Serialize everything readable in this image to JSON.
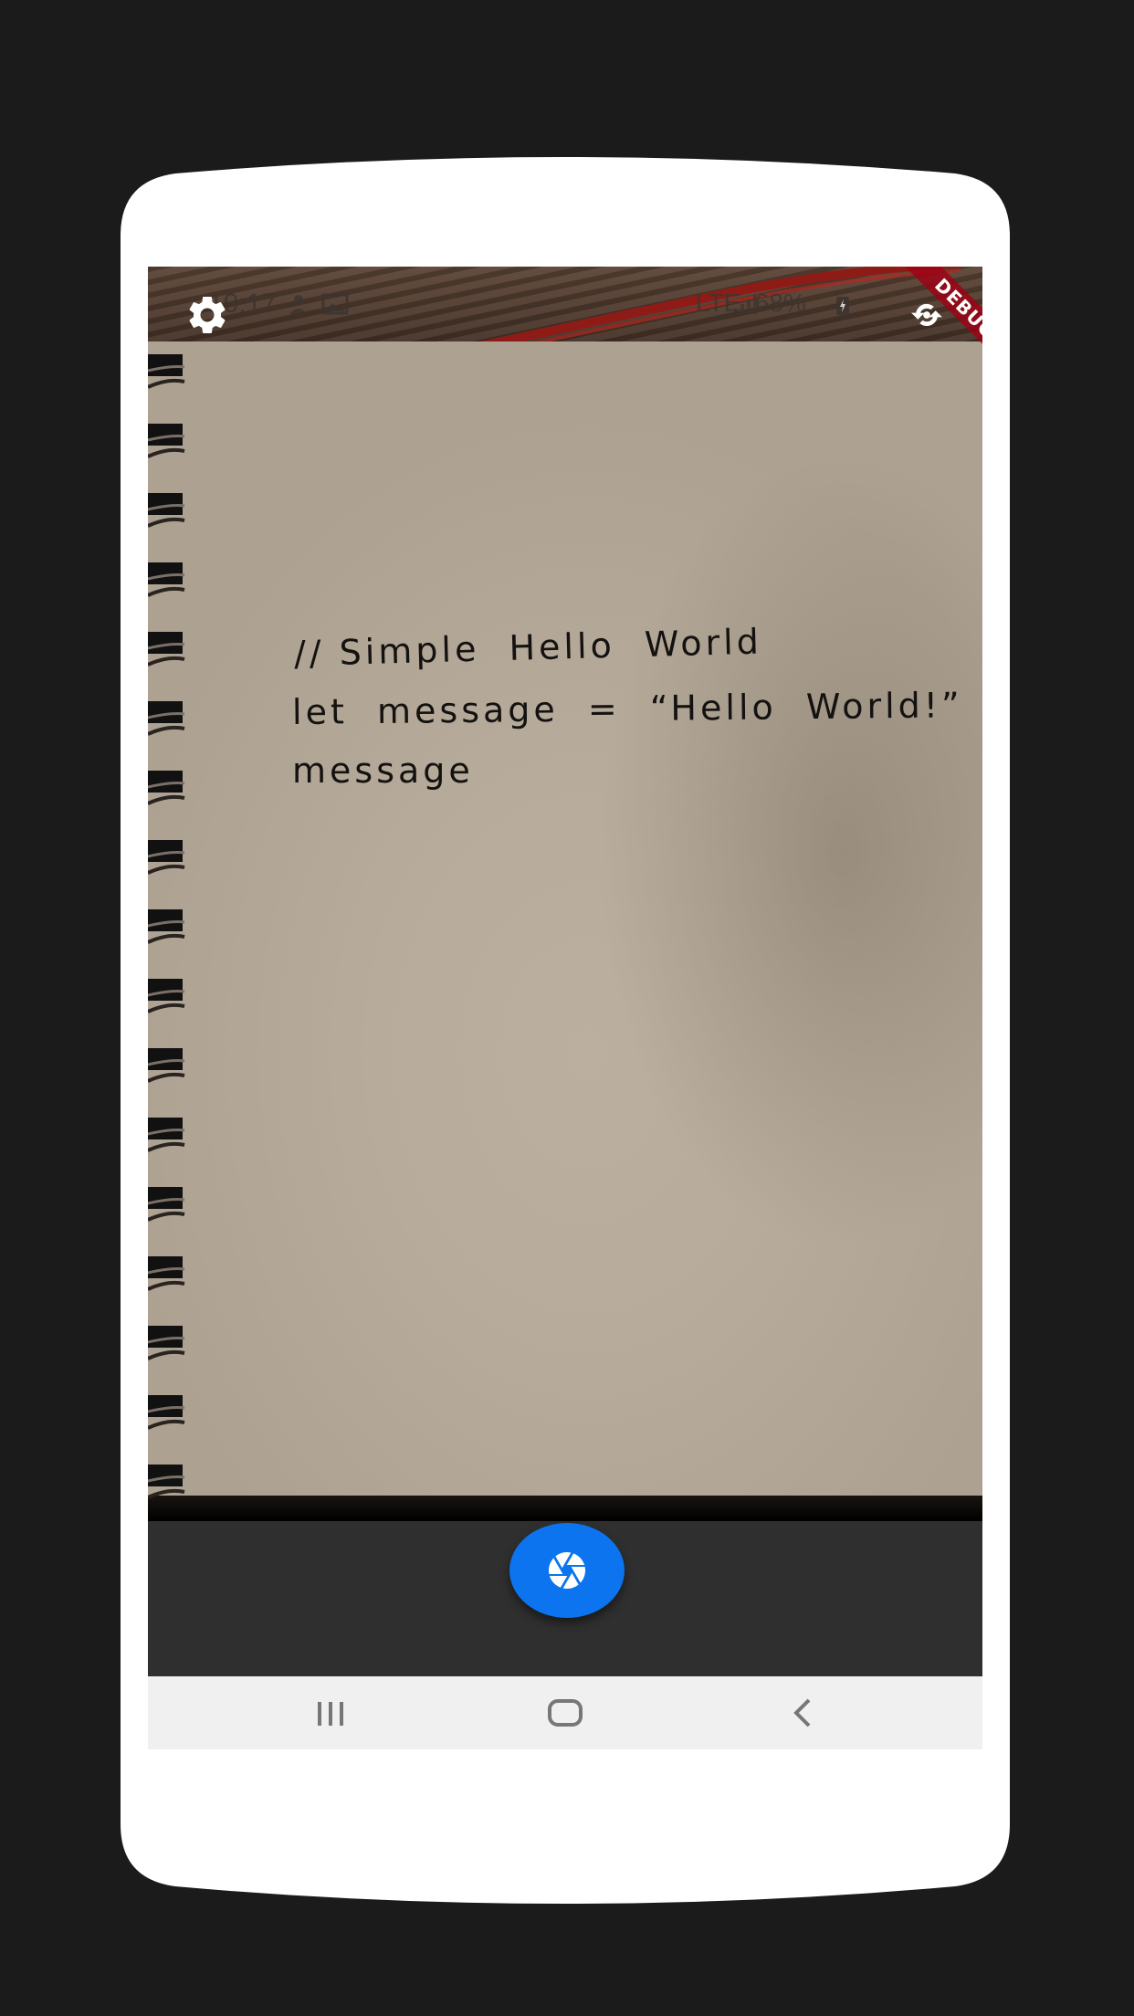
{
  "status_bar": {
    "time": "10:17",
    "right_text": "LTE  68%",
    "battery_percent": "68%",
    "network": "LTE",
    "icons": [
      "person-notification-icon",
      "image-notification-icon",
      "alarm-icon",
      "mute-icon",
      "sd-card-icon",
      "wifi-icon",
      "signal-icon",
      "battery-charging-icon"
    ]
  },
  "debug_banner": {
    "label": "DEBUG"
  },
  "handwriting": {
    "line1": "// Simple  Hello  World",
    "line2": "let  message  =  “Hello  World!”",
    "line3": "message"
  },
  "toolbar": {
    "settings_icon": "gear-icon",
    "flip_camera_icon": "flip-camera-icon",
    "shutter_icon": "camera-shutter-icon"
  },
  "nav_bar": {
    "recents_icon": "recents-icon",
    "home_icon": "home-icon",
    "back_icon": "back-icon"
  },
  "colors": {
    "shutter": "#0b74ee",
    "control_bar": "#2f2f2f",
    "nav_bar": "#f0f0f0",
    "debug_ribbon": "#a00014",
    "background": "#1b1b1b"
  }
}
